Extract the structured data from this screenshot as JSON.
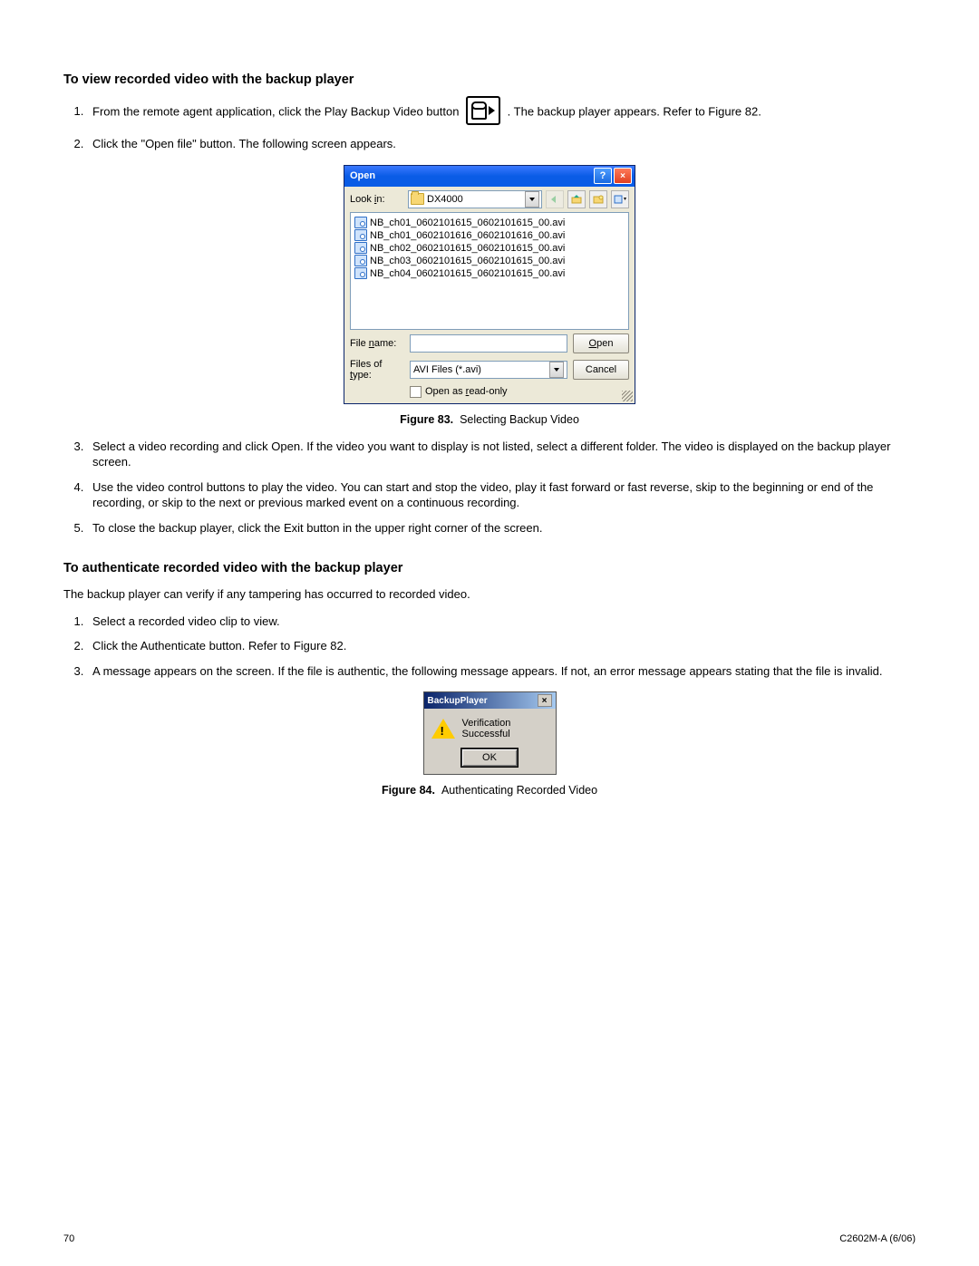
{
  "headings": {
    "view": "To view recorded video with the backup player",
    "auth": "To authenticate recorded video with the backup player"
  },
  "view_steps": {
    "s1a": "From the remote agent application, click the Play Backup Video button ",
    "s1b": ". The backup player appears. Refer to Figure 82.",
    "s2": "Click the \"Open file\" button. The following screen appears.",
    "s3": "Select a video recording and click Open. If the video you want to display is not listed, select a different folder. The video is displayed on the backup player screen.",
    "s4": "Use the video control buttons to play the video. You can start and stop the video, play it fast forward or fast reverse, skip to the beginning or end of the recording, or skip to the next or previous marked event on a continuous recording.",
    "s5": "To close the backup player, click the Exit button in the upper right corner of the screen."
  },
  "fig83": {
    "label": "Figure 83.",
    "caption": "Selecting Backup Video"
  },
  "fig84": {
    "label": "Figure 84.",
    "caption": "Authenticating Recorded Video"
  },
  "auth_intro": "The backup player can verify if any tampering has occurred to recorded video.",
  "auth_steps": {
    "s1": "Select a recorded video clip to view.",
    "s2": "Click the Authenticate button. Refer to Figure 82.",
    "s3": "A message appears on the screen. If the file is authentic, the following message appears. If not, an error message appears stating that the file is invalid."
  },
  "open_dialog": {
    "title": "Open",
    "lookin_label": "Look in:",
    "lookin_value": "DX4000",
    "files": [
      "NB_ch01_0602101615_0602101615_00.avi",
      "NB_ch01_0602101616_0602101616_00.avi",
      "NB_ch02_0602101615_0602101615_00.avi",
      "NB_ch03_0602101615_0602101615_00.avi",
      "NB_ch04_0602101615_0602101615_00.avi"
    ],
    "filename_label": "File name:",
    "filename_value": "",
    "filetype_label": "Files of type:",
    "filetype_value": "AVI Files (*.avi)",
    "readonly_label": "Open as read-only",
    "open_btn": "Open",
    "cancel_btn": "Cancel"
  },
  "msgbox": {
    "title": "BackupPlayer",
    "message": "Verification Successful",
    "ok": "OK"
  },
  "footer": {
    "page": "70",
    "doc": "C2602M-A (6/06)"
  }
}
